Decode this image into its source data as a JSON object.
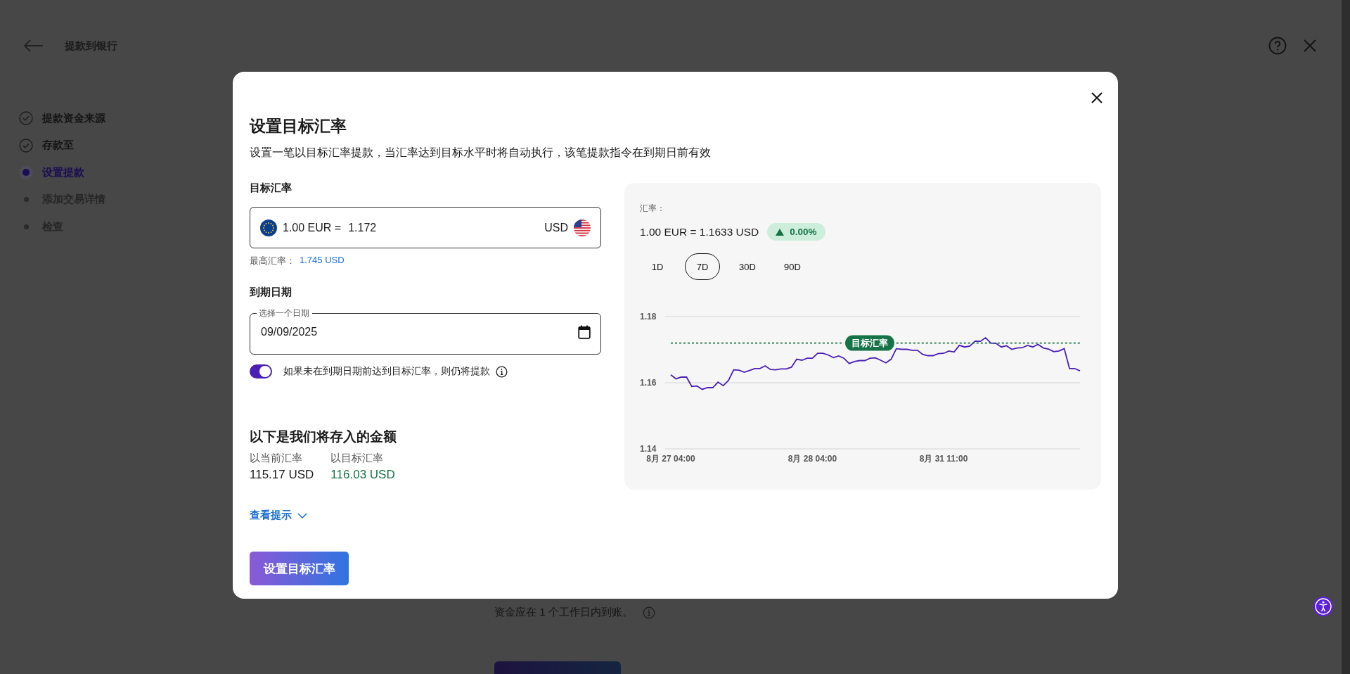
{
  "header": {
    "title": "提款到银行"
  },
  "steps": [
    {
      "label": "提款资金来源",
      "kind": "done"
    },
    {
      "label": "存款至",
      "kind": "done"
    },
    {
      "label": "设置提款",
      "kind": "current"
    },
    {
      "label": "添加交易详情",
      "kind": "pending"
    },
    {
      "label": "检查",
      "kind": "pending"
    }
  ],
  "page_note": "资金应在 1 个工作日内到账。",
  "modal": {
    "title": "设置目标汇率",
    "subtitle": "设置一笔以目标汇率提款，当汇率达到目标水平时将自动执行，该笔提款指令在到期日前有效",
    "rate_label": "目标汇率",
    "rate_field": {
      "base": "1.00 EUR =",
      "value": "1.172",
      "quote": "USD"
    },
    "max_rate_label": "最高汇率：",
    "max_rate_value": "1.745 USD",
    "expiry_label": "到期日期",
    "date_field": {
      "label": "选择一个日期",
      "value": "09/09/2025"
    },
    "fallback_toggle": {
      "on": true,
      "label": "如果未在到期日期前达到目标汇率，则仍将提款"
    },
    "amounts_title": "以下是我们将存入的金额",
    "amounts": [
      {
        "label": "以当前汇率",
        "value": "115.17 USD",
        "kind": "current"
      },
      {
        "label": "以目标汇率",
        "value": "116.03 USD",
        "kind": "target"
      }
    ],
    "tips_link": "查看提示",
    "submit": "设置目标汇率",
    "rate_panel": {
      "label": "汇率：",
      "rate": "1.00 EUR = 1.1633 USD",
      "change": "0.00%",
      "periods": [
        {
          "label": "1D",
          "selected": false
        },
        {
          "label": "7D",
          "selected": true
        },
        {
          "label": "30D",
          "selected": false
        },
        {
          "label": "90D",
          "selected": false
        }
      ],
      "chart_data": {
        "type": "line",
        "categories": [
          "8月 27 04:00",
          null,
          null,
          null,
          null,
          null,
          null,
          null,
          null,
          null,
          null,
          null,
          null,
          null,
          null,
          null,
          null,
          null,
          null,
          null,
          null,
          null,
          null,
          null,
          null,
          null,
          null,
          "8月 28 04:00",
          null,
          null,
          null,
          null,
          null,
          null,
          null,
          null,
          null,
          null,
          null,
          null,
          null,
          null,
          null,
          null,
          null,
          null,
          null,
          null,
          null,
          null,
          null,
          null,
          "8月 31 11:00",
          null,
          null,
          null,
          null,
          null,
          null,
          null,
          null,
          null,
          null,
          null,
          null,
          null,
          null,
          null,
          null,
          null,
          null,
          null,
          null,
          null,
          null,
          null,
          null,
          null,
          null
        ],
        "series": [
          {
            "color": "#4b1fb5",
            "values": [
              1.1624,
              1.1612,
              1.1617,
              1.1617,
              1.1589,
              1.159,
              1.158,
              1.1585,
              1.1585,
              1.1602,
              1.1591,
              1.1607,
              1.1639,
              1.1638,
              1.1632,
              1.1637,
              1.1643,
              1.1643,
              1.1651,
              1.164,
              1.1639,
              1.1642,
              1.1642,
              1.1647,
              1.1671,
              1.1668,
              1.1674,
              1.1674,
              1.1689,
              1.1689,
              1.1684,
              1.1676,
              1.1681,
              1.1674,
              1.1658,
              1.1664,
              1.1667,
              1.1667,
              1.1674,
              1.1675,
              1.1668,
              1.166,
              1.1671,
              1.1703,
              1.1701,
              1.1701,
              1.1698,
              1.1698,
              1.1686,
              1.1682,
              1.1682,
              1.1688,
              1.1689,
              1.1696,
              1.1693,
              1.1713,
              1.1708,
              1.1711,
              1.1726,
              1.1725,
              1.1736,
              1.172,
              1.1719,
              1.1708,
              1.1712,
              1.1701,
              1.1705,
              1.1706,
              1.1713,
              1.1708,
              1.1716,
              1.1705,
              1.1702,
              1.1694,
              1.1696,
              1.1703,
              1.1643,
              1.1643,
              1.1636
            ]
          },
          {
            "name": "目标汇率",
            "color": "#157347",
            "line_style": "dashed",
            "values": [
              1.172,
              1.172,
              1.172,
              1.172,
              1.172,
              1.172,
              1.172,
              1.172,
              1.172,
              1.172,
              1.172,
              1.172,
              1.172,
              1.172,
              1.172,
              1.172,
              1.172,
              1.172,
              1.172,
              1.172,
              1.172,
              1.172,
              1.172,
              1.172,
              1.172,
              1.172,
              1.172,
              1.172,
              1.172,
              1.172,
              1.172,
              1.172,
              1.172,
              1.172,
              null,
              null,
              null,
              null,
              null,
              null,
              null,
              null,
              null,
              1.172,
              1.172,
              1.172,
              1.172,
              1.172,
              1.172,
              1.172,
              1.172,
              1.172,
              1.172,
              1.172,
              1.172,
              1.172,
              1.172,
              1.172,
              1.172,
              1.172,
              1.172,
              1.172,
              1.172,
              1.172,
              1.172,
              1.172,
              1.172,
              1.172,
              1.172,
              1.172,
              1.172,
              1.172,
              1.172,
              1.172,
              1.172,
              1.172,
              1.172,
              1.172,
              1.172
            ]
          }
        ],
        "ylim": [
          1.14,
          1.18
        ],
        "yticks": [
          1.14,
          1.16,
          1.18
        ]
      }
    }
  }
}
